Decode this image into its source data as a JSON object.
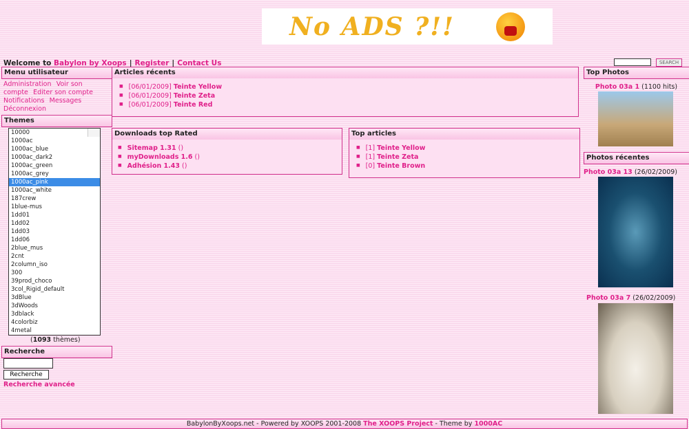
{
  "banner": {
    "text": "No ADS ?!!"
  },
  "welcome": {
    "prefix": "Welcome to",
    "site": "Babylon by Xoops",
    "register": "Register",
    "contact": "Contact Us"
  },
  "search_top": {
    "value": "",
    "button": "SEARCH"
  },
  "user_menu": {
    "title": "Menu utilisateur",
    "links": [
      "Administration",
      "Voir son compte",
      "Editer son compte",
      "Notifications",
      "Messages",
      "Déconnexion"
    ]
  },
  "themes": {
    "title": "Themes",
    "options": [
      "10000",
      "1000ac",
      "1000ac_blue",
      "1000ac_dark2",
      "1000ac_green",
      "1000ac_grey",
      "1000ac_pink",
      "1000ac_white",
      "187crew",
      "1blue-mus",
      "1dd01",
      "1dd02",
      "1dd03",
      "1dd06",
      "2blue_mus",
      "2cnt",
      "2column_iso",
      "300",
      "39prod_choco",
      "3col_Rigid_default",
      "3dBlue",
      "3dWoods",
      "3dblack",
      "4colorbiz",
      "4metal"
    ],
    "selected": "1000ac_pink",
    "count": "1093",
    "count_suffix": "thèmes"
  },
  "recherche": {
    "title": "Recherche",
    "value": "",
    "button": "Recherche",
    "advanced": "Recherche avancée"
  },
  "recent_articles": {
    "title": "Articles récents",
    "items": [
      {
        "date": "[06/01/2009]",
        "title": "Teinte Yellow"
      },
      {
        "date": "[06/01/2009]",
        "title": "Teinte Zeta"
      },
      {
        "date": "[06/01/2009]",
        "title": "Teinte Red"
      }
    ]
  },
  "downloads": {
    "title": "Downloads top Rated",
    "items": [
      {
        "name": "Sitemap 1.31",
        "extra": "()"
      },
      {
        "name": "myDownloads 1.6",
        "extra": "()"
      },
      {
        "name": "Adhésion 1.43",
        "extra": "()"
      }
    ]
  },
  "top_articles": {
    "title": "Top articles",
    "items": [
      {
        "count": "[1]",
        "title": "Teinte Yellow"
      },
      {
        "count": "[1]",
        "title": "Teinte Zeta"
      },
      {
        "count": "[0]",
        "title": "Teinte Brown"
      }
    ]
  },
  "top_photos": {
    "title": "Top Photos",
    "photo": {
      "name": "Photo 03a 1",
      "info": "(1100 hits)"
    }
  },
  "recent_photos": {
    "title": "Photos récentes",
    "photos": [
      {
        "name": "Photo 03a 13",
        "info": "(26/02/2009)"
      },
      {
        "name": "Photo 03a 7",
        "info": "(26/02/2009)"
      }
    ]
  },
  "footer": {
    "text": "BabylonByXoops.net - Powered by XOOPS 2001-2008",
    "xoops": "The XOOPS Project",
    "mid": "- Theme by",
    "theme": "1000AC"
  }
}
